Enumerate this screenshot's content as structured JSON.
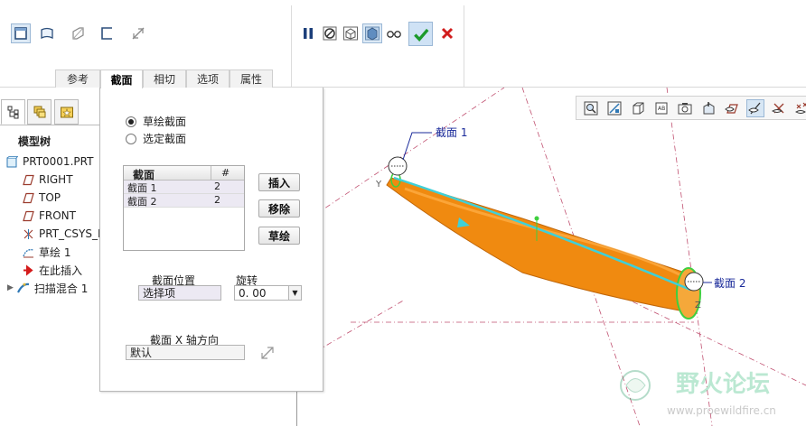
{
  "ribbon": {
    "tool_groups": {
      "left_icons": [
        "solid-icon",
        "surface-icon",
        "thin-icon",
        "open-end-icon",
        "remove-material-icon"
      ],
      "right_icons": [
        "pause-icon",
        "no-preview-icon",
        "preview-geometry-icon",
        "verify-icon",
        "glasses-icon",
        "ok-check-icon",
        "cancel-x-icon"
      ]
    },
    "tabs": [
      {
        "label": "参考"
      },
      {
        "label": "截面"
      },
      {
        "label": "相切"
      },
      {
        "label": "选项"
      },
      {
        "label": "属性"
      }
    ],
    "active_tab": "截面"
  },
  "left_panel": {
    "tabs": [
      "model-tree-icon",
      "layers-icon",
      "favorites-icon"
    ],
    "title": "模型树",
    "tree": [
      {
        "label": "PRT0001.PRT",
        "icon": "part-icon"
      },
      {
        "label": "RIGHT",
        "icon": "datum-plane-icon"
      },
      {
        "label": "TOP",
        "icon": "datum-plane-icon"
      },
      {
        "label": "FRONT",
        "icon": "datum-plane-icon"
      },
      {
        "label": "PRT_CSYS_D",
        "icon": "csys-icon"
      },
      {
        "label": "草绘 1",
        "icon": "sketch-icon"
      },
      {
        "label": "在此插入",
        "icon": "insert-arrow-icon"
      },
      {
        "label": "扫描混合 1",
        "icon": "sweep-blend-icon"
      }
    ]
  },
  "section_panel": {
    "radio_sketched": "草绘截面",
    "radio_selected": "选定截面",
    "sketched_selected": true,
    "table": {
      "headers": [
        "截面",
        "#"
      ],
      "rows": [
        [
          "截面 1",
          "2"
        ],
        [
          "截面 2",
          "2"
        ]
      ]
    },
    "buttons": {
      "insert": "插入",
      "remove": "移除",
      "sketch": "草绘"
    },
    "position_label": "截面位置",
    "position_value": "选择项",
    "rotation_label": "旋转",
    "rotation_value": "0. 00",
    "xaxis_label": "截面 X 轴方向",
    "xaxis_value": "默认"
  },
  "graphics": {
    "callout_1": "截面 1",
    "callout_2": "截面 2",
    "axis_label_y": "Y",
    "axis_label_z": "Z",
    "colors": {
      "sweep_body": "#f08a10",
      "trajectory": "#3fd0d8",
      "datum_lines": "#c05070",
      "callout_text": "#1a2a9a"
    }
  },
  "watermark": {
    "title": "野火论坛",
    "url": "www.proewildfire.cn"
  },
  "view_toolbar": {
    "icons": [
      "refit-icon",
      "zoom-in-icon",
      "repaint-icon",
      "display-style-icon",
      "saved-views-icon",
      "view-manager-icon",
      "annotation-icon",
      "datum-plane-display-icon",
      "datum-axis-display-icon",
      "point-display-icon",
      "csys-display-icon"
    ]
  }
}
